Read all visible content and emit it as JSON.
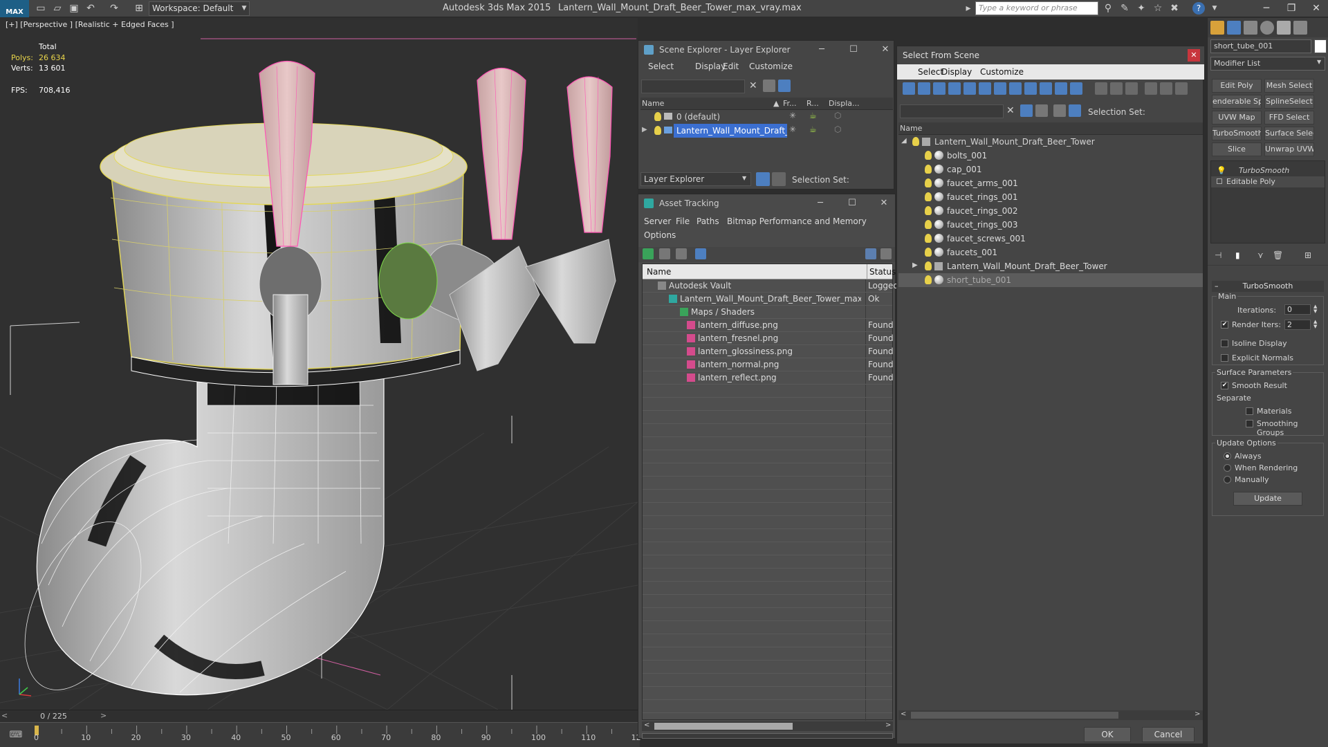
{
  "titlebar": {
    "logo": "MAX",
    "workspace": "Workspace: Default",
    "app_title": "Autodesk 3ds Max  2015",
    "file_title": "Lantern_Wall_Mount_Draft_Beer_Tower_max_vray.max",
    "search_placeholder": "Type a keyword or phrase"
  },
  "viewport": {
    "label": "[+] [Perspective ] [Realistic + Edged Faces ]",
    "stats": {
      "total_label": "Total",
      "polys_label": "Polys:",
      "polys_value": "26 634",
      "verts_label": "Verts:",
      "verts_value": "13 601",
      "fps_label": "FPS:",
      "fps_value": "708,416"
    }
  },
  "timeline": {
    "frame_display": "0 / 225",
    "ticks": [
      "0",
      "10",
      "20",
      "30",
      "40",
      "50",
      "60",
      "70",
      "80",
      "90",
      "100",
      "110",
      "12"
    ]
  },
  "scene_explorer": {
    "title": "Scene Explorer - Layer Explorer",
    "menu": [
      "Select",
      "Display",
      "Edit",
      "Customize"
    ],
    "columns": [
      "Name",
      "Fr...",
      "R...",
      "Displa..."
    ],
    "rows": [
      "0 (default)",
      "Lantern_Wall_Mount_Draft_Beer_To..."
    ],
    "footer_dropdown": "Layer Explorer",
    "selection_set_label": "Selection Set:"
  },
  "asset_tracking": {
    "title": "Asset Tracking",
    "menu": [
      "Server",
      "File",
      "Paths",
      "Bitmap Performance and Memory",
      "Options"
    ],
    "columns": [
      "Name",
      "Status"
    ],
    "rows": [
      {
        "name": "Autodesk Vault",
        "status": "Logged"
      },
      {
        "name": "Lantern_Wall_Mount_Draft_Beer_Tower_max_vr...",
        "status": "Ok"
      },
      {
        "name": "Maps / Shaders",
        "status": ""
      },
      {
        "name": "lantern_diffuse.png",
        "status": "Found"
      },
      {
        "name": "lantern_fresnel.png",
        "status": "Found"
      },
      {
        "name": "lantern_glossiness.png",
        "status": "Found"
      },
      {
        "name": "lantern_normal.png",
        "status": "Found"
      },
      {
        "name": "lantern_reflect.png",
        "status": "Found"
      }
    ]
  },
  "select_from_scene": {
    "title": "Select From Scene",
    "menu": [
      "Select",
      "Display",
      "Customize"
    ],
    "selection_set_label": "Selection Set:",
    "column": "Name",
    "root": "Lantern_Wall_Mount_Draft_Beer_Tower",
    "items": [
      "bolts_001",
      "cap_001",
      "faucet_arms_001",
      "faucet_rings_001",
      "faucet_rings_002",
      "faucet_rings_003",
      "faucet_screws_001",
      "faucets_001",
      "Lantern_Wall_Mount_Draft_Beer_Tower",
      "short_tube_001"
    ],
    "ok": "OK",
    "cancel": "Cancel"
  },
  "command_panel": {
    "object_name": "short_tube_001",
    "modifier_list": "Modifier List",
    "buttons": [
      "Edit Poly",
      "Mesh Select",
      "enderable Splin",
      "SplineSelect",
      "UVW Map",
      "FFD Select",
      "TurboSmooth",
      "Surface Select",
      "Slice",
      "Unwrap UVW"
    ],
    "stack": [
      "TurboSmooth",
      "Editable Poly"
    ],
    "turbosmooth": {
      "title": "TurboSmooth",
      "main": "Main",
      "iterations_label": "Iterations:",
      "iterations_value": "0",
      "render_iters_label": "Render Iters:",
      "render_iters_value": "2",
      "isoline": "Isoline Display",
      "explicit_normals": "Explicit Normals",
      "surface_params": "Surface Parameters",
      "smooth_result": "Smooth Result",
      "separate": "Separate",
      "materials": "Materials",
      "smoothing_groups": "Smoothing Groups",
      "update_options": "Update Options",
      "always": "Always",
      "when_rendering": "When Rendering",
      "manually": "Manually",
      "update_button": "Update"
    }
  },
  "colors": {
    "accent": "#1e5f86",
    "wire": "#ff4fb2",
    "selection": "#3b6fd1"
  }
}
